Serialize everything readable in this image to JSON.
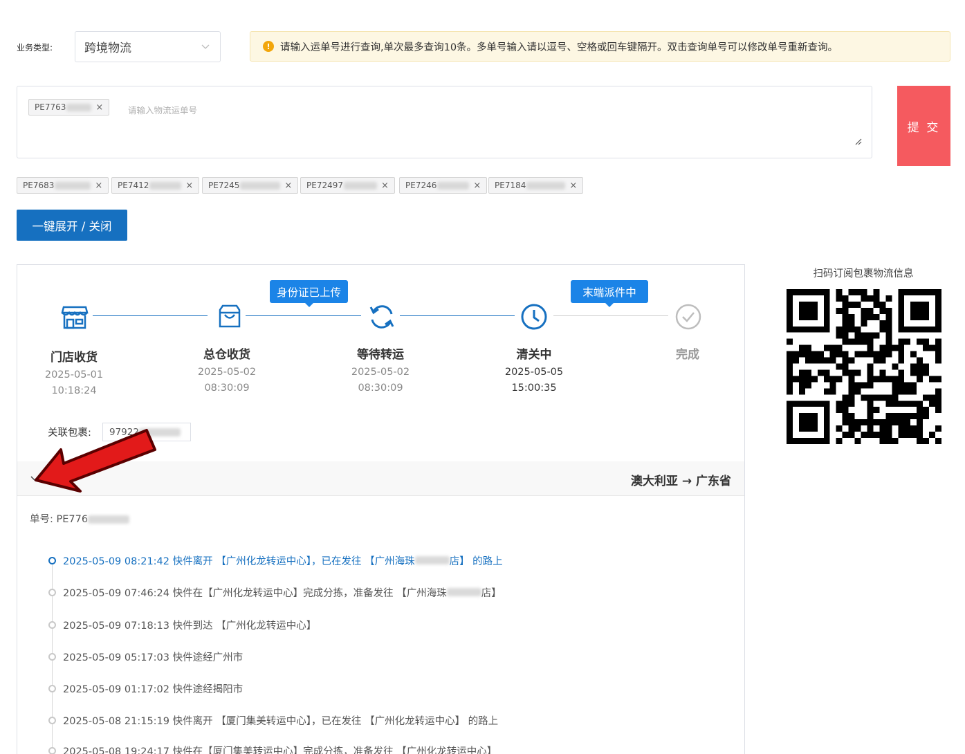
{
  "filters": {
    "business_type_label": "业务类型:",
    "business_type_value": "跨境物流"
  },
  "notice": {
    "icon": "!",
    "text": "请输入运单号进行查询,单次最多查询10条。多单号输入请以逗号、空格或回车键隔开。双击查询单号可以修改单号重新查询。"
  },
  "input": {
    "current_tag": "PE7763",
    "placeholder": "请输入物流运单号"
  },
  "submit_label": "提 交",
  "history_tags": [
    "PE7683",
    "PE7412",
    "PE7245",
    "PE72497",
    "PE7246",
    "PE7184"
  ],
  "expand_label": "一键展开 / 关闭",
  "tracking": {
    "bubbles": [
      "身份证已上传",
      "末端派件中"
    ],
    "steps": [
      {
        "name": "门店收货",
        "date": "2025-05-01",
        "time": "10:18:24"
      },
      {
        "name": "总仓收货",
        "date": "2025-05-02",
        "time": "08:30:09"
      },
      {
        "name": "等待转运",
        "date": "2025-05-02",
        "time": "08:30:09"
      },
      {
        "name": "清关中",
        "date": "2025-05-05",
        "time": "15:00:35"
      },
      {
        "name": "完成",
        "date": "",
        "time": ""
      }
    ],
    "package_label": "关联包裹:",
    "package_value": "97922",
    "route": "澳大利亚 → 广东省",
    "order_label": "单号:",
    "order_value": "PE776"
  },
  "timeline": [
    {
      "parts": [
        "2025-05-09 08:21:42 快件离开 【广州化龙转运中心】，已在发往 【广州海珠",
        "店】 的路上"
      ]
    },
    {
      "parts": [
        "2025-05-09 07:46:24 快件在【广州化龙转运中心】完成分拣，准备发往 【广州海珠",
        "店】"
      ]
    },
    {
      "parts": [
        "2025-05-09 07:18:13 快件到达 【广州化龙转运中心】"
      ]
    },
    {
      "parts": [
        "2025-05-09 05:17:03 快件途经广州市"
      ]
    },
    {
      "parts": [
        "2025-05-09 01:17:02 快件途经揭阳市"
      ]
    },
    {
      "parts": [
        "2025-05-08 21:15:19 快件离开 【厦门集美转运中心】，已在发往 【广州化龙转运中心】 的路上"
      ]
    },
    {
      "parts": [
        "2025-05-08 19:24:17 快件在【厦门集美转运中心】完成分拣，准备发往 【广州化龙转运中心】"
      ]
    }
  ],
  "qr_title": "扫码订阅包裹物流信息",
  "colors": {
    "primary": "#1670c0",
    "bubble": "#1b84e7",
    "submit": "#f55a5f",
    "notice_bg": "#fdf7e3",
    "warn": "#f2a60c",
    "arrow": "#e21a1a"
  }
}
